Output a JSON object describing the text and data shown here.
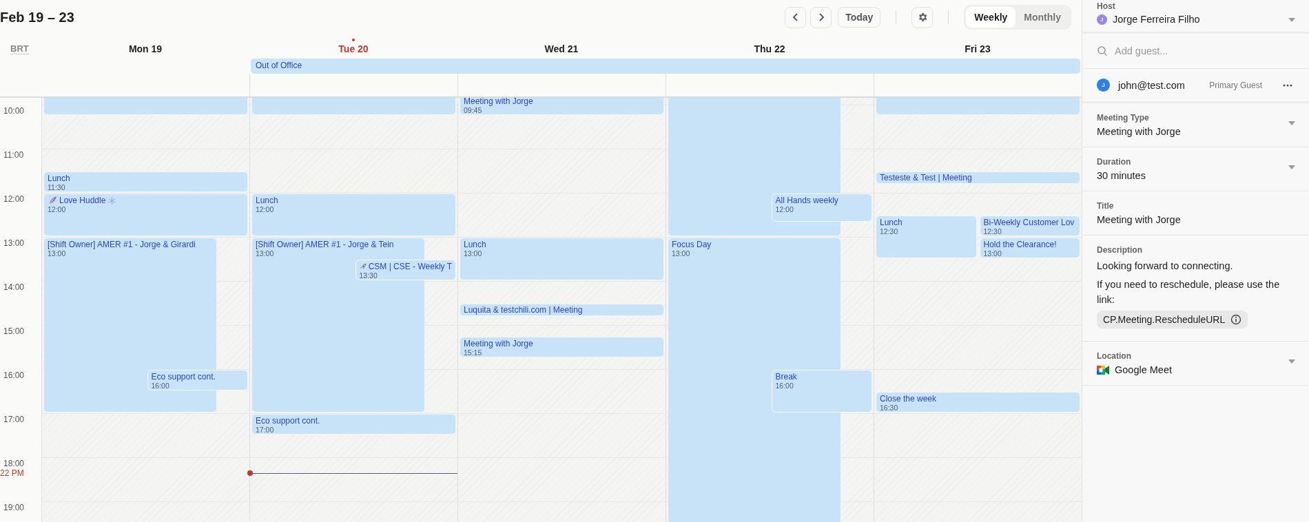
{
  "toolbar": {
    "title": "Feb 19 – 23",
    "today_button": "Today",
    "views": [
      {
        "label": "Weekly",
        "selected": true
      },
      {
        "label": "Monthly",
        "selected": false
      }
    ]
  },
  "calendar": {
    "timezone": "BRT",
    "days": [
      {
        "label": "Mon 19",
        "today": false,
        "events": [
          {
            "kind": "blank"
          },
          {
            "kind": "plain",
            "title": "Lunch",
            "time": "11:30"
          },
          {
            "kind": "social",
            "title": "Love Huddle",
            "time": "12:00"
          },
          {
            "kind": "plain",
            "title": "[Shift Owner] AMER #1 - Jorge & Girardi",
            "time": "13:00"
          },
          {
            "kind": "plain",
            "title": "Eco support cont.",
            "time": "16:00"
          }
        ]
      },
      {
        "label": "Tue 20",
        "today": true,
        "events": [
          {
            "kind": "blank"
          },
          {
            "kind": "plain",
            "title": "Lunch",
            "time": "12:00"
          },
          {
            "kind": "plain",
            "title": "[Shift Owner] AMER #1 - Jorge & Tein",
            "time": "13:00"
          },
          {
            "kind": "launch",
            "title": "CSM | CSE - Weekly T",
            "time": "13:30"
          },
          {
            "kind": "plain",
            "title": "Eco support cont.",
            "time": "17:00"
          }
        ]
      },
      {
        "label": "Wed 21",
        "today": false,
        "events": [
          {
            "kind": "plain",
            "title": "Meeting with Jorge",
            "time": "09:45"
          },
          {
            "kind": "plain",
            "title": "Lunch",
            "time": "13:00"
          },
          {
            "kind": "plain",
            "title": "Luquita & testchili.com | Meeting"
          },
          {
            "kind": "plain",
            "title": "Meeting with Jorge",
            "time": "15:15"
          }
        ]
      },
      {
        "label": "Thu 22",
        "today": false,
        "events": [
          {
            "kind": "blank"
          },
          {
            "kind": "plain",
            "title": "All Hands weekly",
            "time": "12:00"
          },
          {
            "kind": "plain",
            "title": "Focus Day",
            "time": "13:00"
          },
          {
            "kind": "plain",
            "title": "Break",
            "time": "16:00"
          }
        ]
      },
      {
        "label": "Fri 23",
        "today": false,
        "events": [
          {
            "kind": "blank"
          },
          {
            "kind": "plain",
            "title": "Testeste & Test | Meeting"
          },
          {
            "kind": "plain",
            "title": "Lunch",
            "time": "12:30"
          },
          {
            "kind": "plain",
            "title": "Bi-Weekly Customer Lov",
            "time": "12:30"
          },
          {
            "kind": "plain",
            "title": "Hold the Clearance!",
            "time": "13:00"
          },
          {
            "kind": "plain",
            "title": "Close the week",
            "time": "16:30"
          }
        ]
      }
    ],
    "all_day_events": [
      {
        "title": "Out of Office"
      }
    ],
    "hours": [
      "10:00",
      "11:00",
      "12:00",
      "13:00",
      "14:00",
      "15:00",
      "16:00",
      "17:00",
      "18:00",
      "19:00"
    ],
    "current_time": {
      "label": "22 PM"
    }
  },
  "panel": {
    "host": {
      "label": "Host",
      "avatar": "J",
      "name": "Jorge Ferreira Filho"
    },
    "guest_search": {
      "placeholder": "Add guest..."
    },
    "guests": [
      {
        "avatar": "J",
        "email": "john@test.com",
        "role": "Primary Guest"
      }
    ],
    "fields": [
      {
        "kind": "dropdown",
        "label": "Meeting Type",
        "value": "Meeting with Jorge"
      },
      {
        "kind": "dropdown",
        "label": "Duration",
        "value": "30 minutes"
      },
      {
        "kind": "text",
        "label": "Title",
        "value": "Meeting with Jorge"
      },
      {
        "kind": "description",
        "label": "Description",
        "lines": [
          "Looking forward to connecting.",
          "If you need to reschedule, please use the link:"
        ],
        "chip": "CP.Meeting.RescheduleURL"
      },
      {
        "kind": "location",
        "label": "Location",
        "value": "Google Meet"
      }
    ]
  }
}
